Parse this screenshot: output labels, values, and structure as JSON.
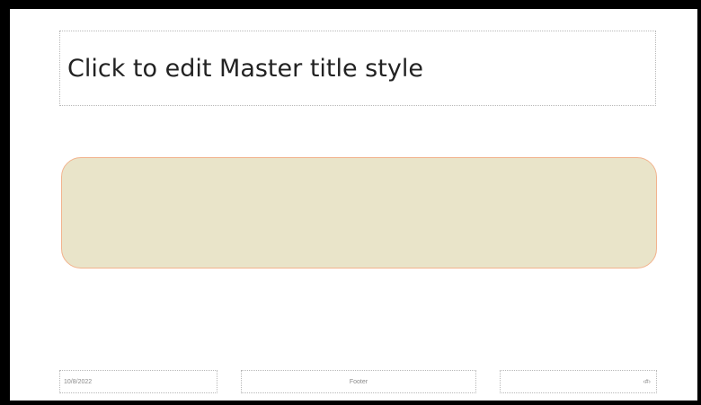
{
  "slide": {
    "title": "Click to edit Master title style",
    "date": "10/8/2022",
    "footer": "Footer",
    "slide_number": "‹#›"
  },
  "colors": {
    "frame": "#000000",
    "shape_fill": "#e9e4c9",
    "shape_border": "#f2b38d"
  }
}
